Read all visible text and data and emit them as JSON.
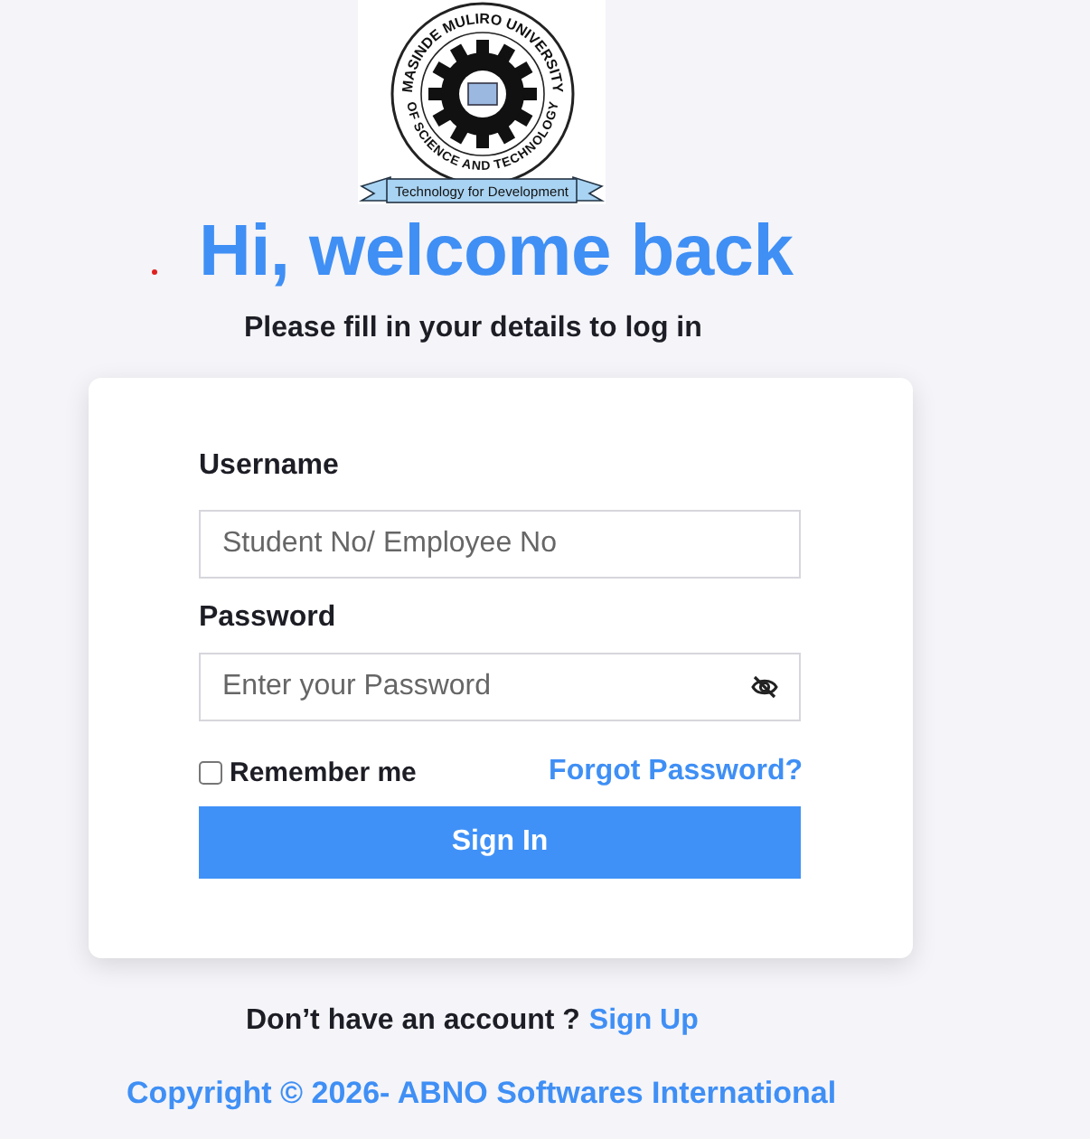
{
  "logo": {
    "arc_top": "MASINDE MULIRO UNIVERSITY",
    "arc_bottom": "OF SCIENCE AND TECHNOLOGY",
    "ribbon": "Technology for Development"
  },
  "heading": "Hi, welcome back",
  "subtitle": "Please fill in your details to log in",
  "form": {
    "fields": [
      {
        "label": "Username",
        "placeholder": "Student No/ Employee No",
        "kind": "text"
      },
      {
        "label": "Password",
        "placeholder": "Enter your Password",
        "kind": "password"
      }
    ],
    "remember": {
      "label": "Remember me",
      "checked": false
    },
    "forgot_link": "Forgot Password?",
    "submit": "Sign In"
  },
  "signup": {
    "prompt": "Don’t have an account ?",
    "link": "Sign Up"
  },
  "copyright": "Copyright © 2026- ABNO Softwares International"
}
